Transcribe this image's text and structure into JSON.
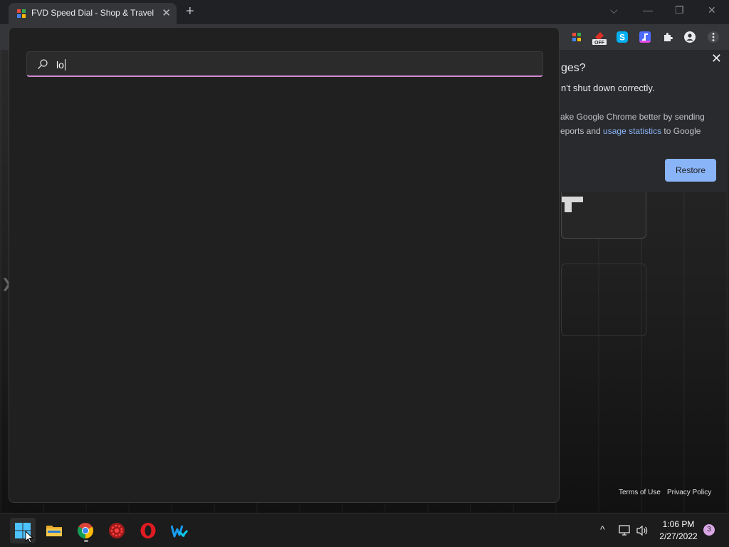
{
  "browser": {
    "tab_title": "FVD Speed Dial - Shop & Travel",
    "tab_close": "✕",
    "new_tab": "+",
    "window_controls": {
      "dropdown": "⌵",
      "minimize": "—",
      "restore": "❐",
      "close": "✕"
    },
    "extensions": [
      {
        "icon": "fvd-speed-dial-icon",
        "color": "#e94b3c"
      },
      {
        "icon": "extension-off-icon",
        "badge": "OFF",
        "color": "#d93025"
      },
      {
        "icon": "skype-icon",
        "color": "#00aff0"
      },
      {
        "icon": "music-note-icon",
        "color": "#e94be3"
      },
      {
        "icon": "puzzle-icon",
        "color": "#e8eaed"
      },
      {
        "icon": "profile-icon",
        "color": "#e8eaed"
      },
      {
        "icon": "menu-icon",
        "color": "#e8eaed"
      }
    ]
  },
  "restore_popup": {
    "title_partial": "ges?",
    "message_partial": "n't shut down correctly.",
    "help_line1": "ake Google Chrome better by sending",
    "help_line2_prefix": "eports and ",
    "help_link": "usage statistics",
    "help_line2_suffix": " to Google",
    "restore_label": "Restore",
    "close_label": "✕"
  },
  "page": {
    "footer_links": [
      "Terms of Use",
      "Privacy Policy"
    ],
    "side_chevron": "❯"
  },
  "search": {
    "query": "lo",
    "accent": "#d28ad6"
  },
  "taskbar": {
    "apps": [
      {
        "name": "start-button",
        "icon": "windows-logo-icon"
      },
      {
        "name": "file-explorer",
        "icon": "folder-icon"
      },
      {
        "name": "chrome",
        "icon": "chrome-icon",
        "running": true
      },
      {
        "name": "antivirus",
        "icon": "shield-gear-icon"
      },
      {
        "name": "opera",
        "icon": "opera-icon"
      },
      {
        "name": "writer",
        "icon": "w-icon"
      }
    ],
    "tray": {
      "chevron": "^",
      "network": "▭",
      "volume": "🔈"
    },
    "time": "1:06 PM",
    "date": "2/27/2022",
    "notifications": "3"
  }
}
